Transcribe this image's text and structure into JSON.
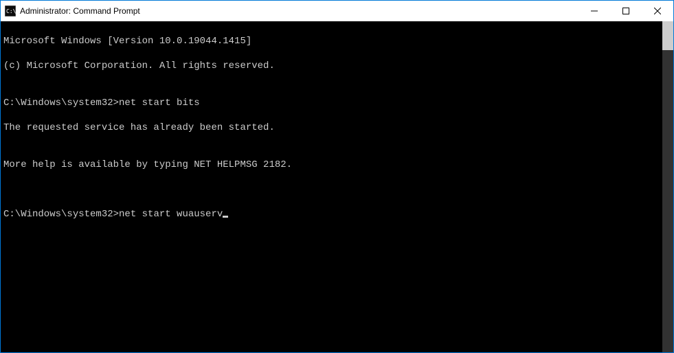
{
  "window": {
    "title": "Administrator: Command Prompt"
  },
  "console": {
    "lines": {
      "l0": "Microsoft Windows [Version 10.0.19044.1415]",
      "l1": "(c) Microsoft Corporation. All rights reserved.",
      "l2": "",
      "l3_prompt": "C:\\Windows\\system32>",
      "l3_cmd": "net start bits",
      "l4": "The requested service has already been started.",
      "l5": "",
      "l6": "More help is available by typing NET HELPMSG 2182.",
      "l7": "",
      "l8": "",
      "l9_prompt": "C:\\Windows\\system32>",
      "l9_cmd": "net start wuauserv"
    }
  }
}
